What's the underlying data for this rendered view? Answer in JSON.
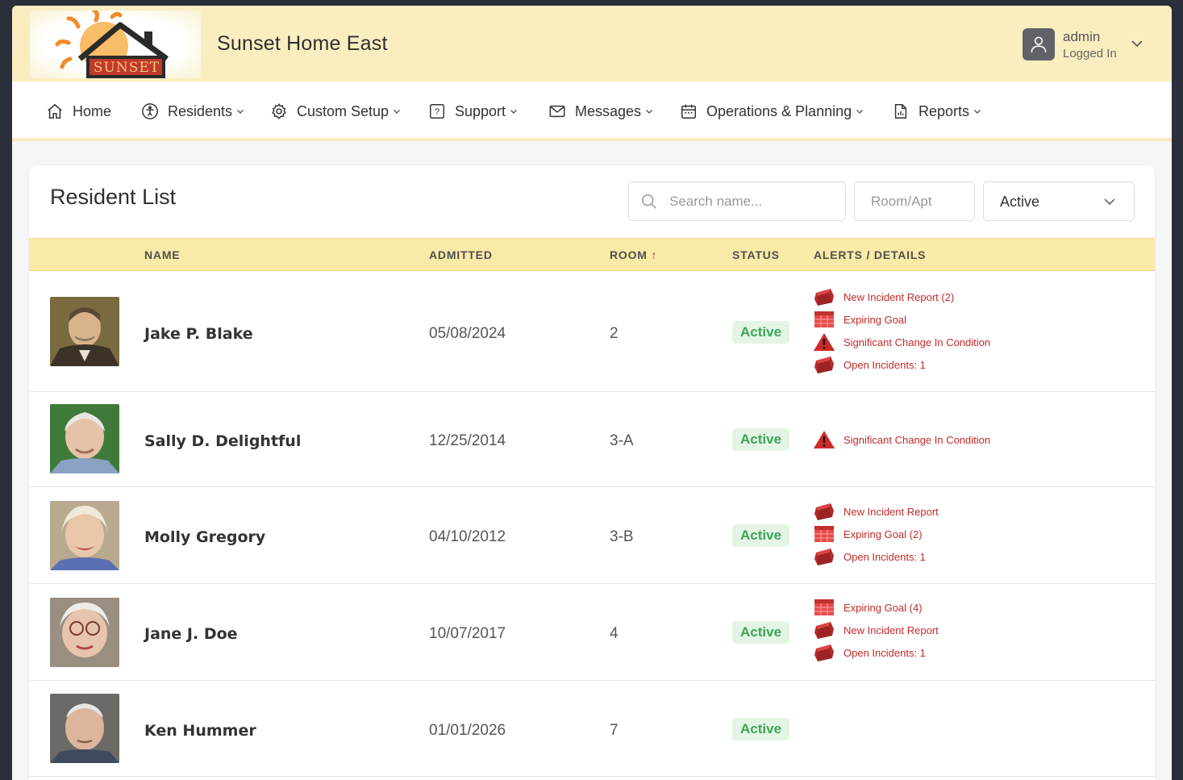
{
  "header": {
    "logo_text": "SUNSET",
    "facility_name": "Sunset Home East",
    "user": {
      "name": "admin",
      "status": "Logged In"
    }
  },
  "nav": [
    {
      "label": "Home",
      "icon": "home-icon",
      "has_caret": false
    },
    {
      "label": "Residents",
      "icon": "accessibility-icon",
      "has_caret": true
    },
    {
      "label": "Custom Setup",
      "icon": "gear-icon",
      "has_caret": true
    },
    {
      "label": "Support",
      "icon": "help-icon",
      "has_caret": true
    },
    {
      "label": "Messages",
      "icon": "envelope-icon",
      "has_caret": true
    },
    {
      "label": "Operations & Planning",
      "icon": "calendar-icon",
      "has_caret": true
    },
    {
      "label": "Reports",
      "icon": "report-icon",
      "has_caret": true
    }
  ],
  "page": {
    "title": "Resident List",
    "search_placeholder": "Search name...",
    "room_placeholder": "Room/Apt",
    "status_filter": "Active"
  },
  "table": {
    "headers": {
      "name": "NAME",
      "admitted": "ADMITTED",
      "room": "ROOM ↑",
      "status": "STATUS",
      "alerts": "ALERTS / DETAILS"
    },
    "rows": [
      {
        "name": "Jake P. Blake",
        "admitted": "05/08/2024",
        "room": "2",
        "status": "Active",
        "alerts": [
          {
            "icon": "incident-icon",
            "text": "New Incident Report (2)"
          },
          {
            "icon": "calendar-goal-icon",
            "text": "Expiring Goal"
          },
          {
            "icon": "warning-icon",
            "text": "Significant Change In Condition"
          },
          {
            "icon": "incident-icon",
            "text": "Open Incidents: 1"
          }
        ]
      },
      {
        "name": "Sally D. Delightful",
        "admitted": "12/25/2014",
        "room": "3-A",
        "status": "Active",
        "alerts": [
          {
            "icon": "warning-icon",
            "text": "Significant Change In Condition"
          }
        ]
      },
      {
        "name": "Molly Gregory",
        "admitted": "04/10/2012",
        "room": "3-B",
        "status": "Active",
        "alerts": [
          {
            "icon": "incident-icon",
            "text": "New Incident Report"
          },
          {
            "icon": "calendar-goal-icon",
            "text": "Expiring Goal (2)"
          },
          {
            "icon": "incident-icon",
            "text": "Open Incidents: 1"
          }
        ]
      },
      {
        "name": "Jane J. Doe",
        "admitted": "10/07/2017",
        "room": "4",
        "status": "Active",
        "alerts": [
          {
            "icon": "calendar-goal-icon",
            "text": "Expiring Goal (4)"
          },
          {
            "icon": "incident-icon",
            "text": "New Incident Report"
          },
          {
            "icon": "incident-icon",
            "text": "Open Incidents: 1"
          }
        ]
      },
      {
        "name": "Ken Hummer",
        "admitted": "01/01/2026",
        "room": "7",
        "status": "Active",
        "alerts": []
      }
    ]
  },
  "colors": {
    "header_bg": "#faeec0",
    "table_header_bg": "#faeaa8",
    "status_active_bg": "#e4f5e6",
    "status_active_text": "#3aa655",
    "alert_text": "#c42a2a"
  }
}
